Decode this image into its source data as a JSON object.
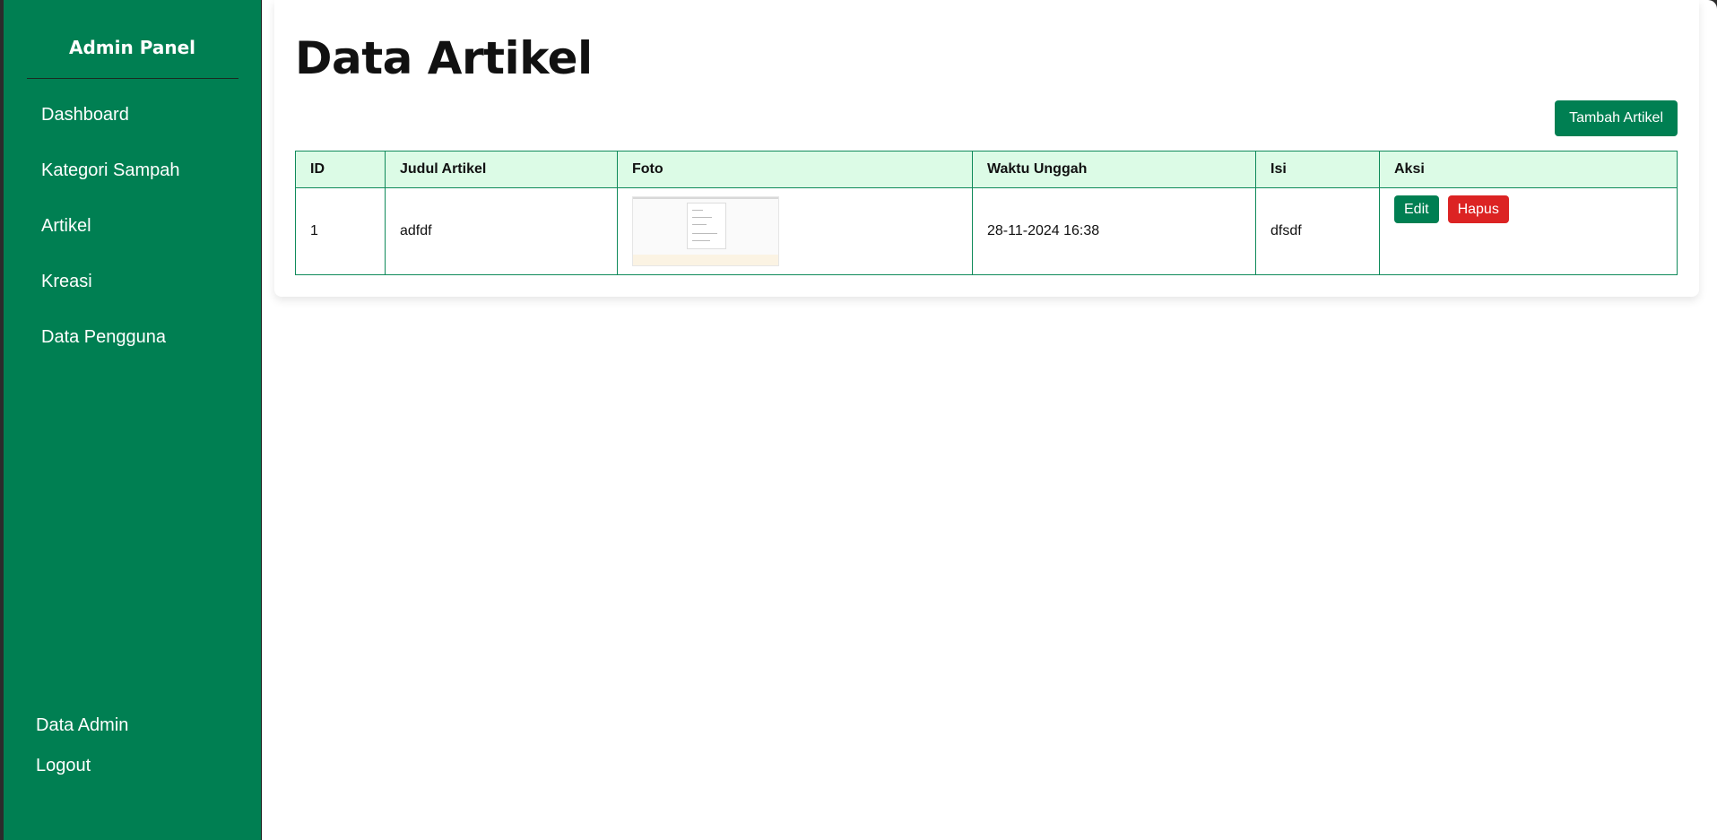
{
  "sidebar": {
    "brand": "Admin Panel",
    "items": [
      {
        "label": "Dashboard"
      },
      {
        "label": "Kategori Sampah"
      },
      {
        "label": "Artikel"
      },
      {
        "label": "Kreasi"
      },
      {
        "label": "Data Pengguna"
      }
    ],
    "bottom_items": [
      {
        "label": "Data Admin"
      },
      {
        "label": "Logout"
      }
    ]
  },
  "main": {
    "title": "Data Artikel",
    "add_button_label": "Tambah Artikel",
    "table": {
      "columns": [
        "ID",
        "Judul Artikel",
        "Foto",
        "Waktu Unggah",
        "Isi",
        "Aksi"
      ],
      "rows": [
        {
          "id": "1",
          "judul": "adfdf",
          "waktu": "28-11-2024 16:38",
          "isi": "dfsdf",
          "edit_label": "Edit",
          "delete_label": "Hapus"
        }
      ]
    }
  },
  "colors": {
    "sidebar_bg": "#007f52",
    "header_bg": "#dcfbe6",
    "primary": "#007f52",
    "danger": "#dc2323"
  }
}
